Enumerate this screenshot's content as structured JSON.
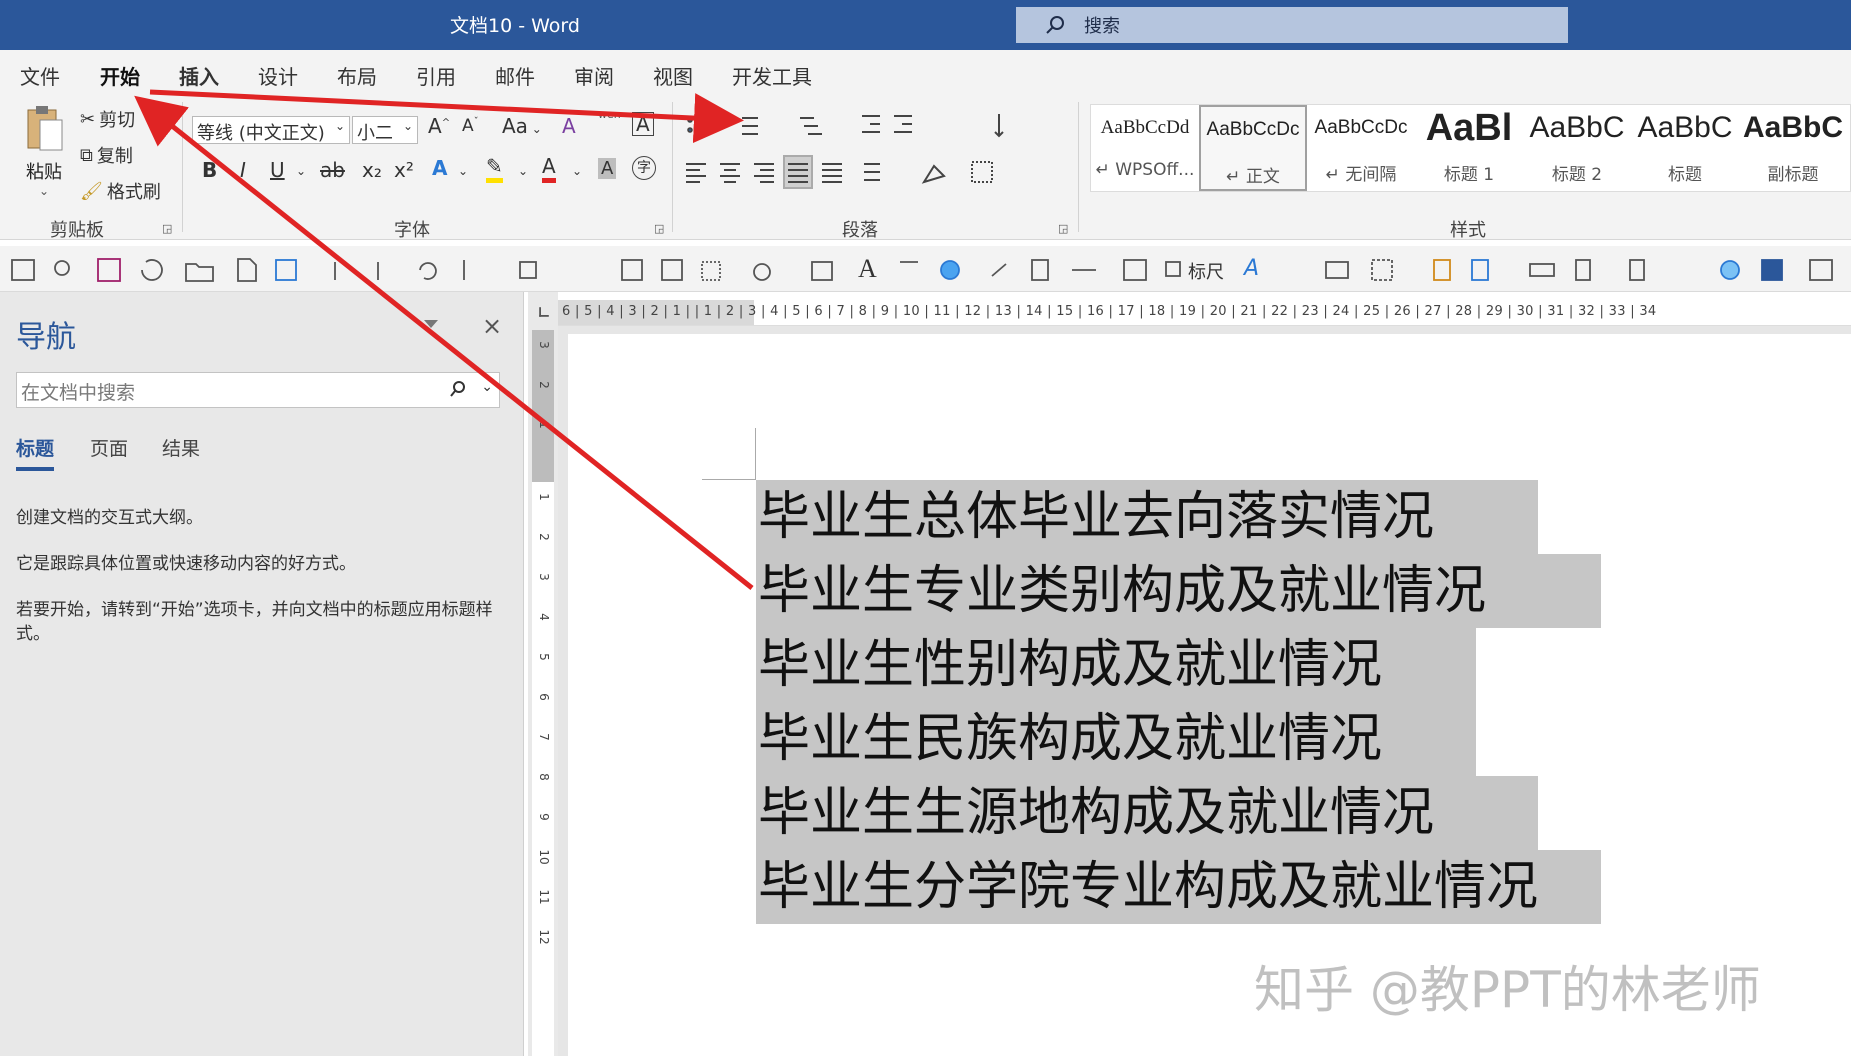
{
  "window": {
    "title": "文档10  -  Word",
    "search_label": "搜索"
  },
  "tabs": [
    "文件",
    "开始",
    "插入",
    "设计",
    "布局",
    "引用",
    "邮件",
    "审阅",
    "视图",
    "开发工具"
  ],
  "ribbon": {
    "clipboard": {
      "paste": "粘贴",
      "cut": "剪切",
      "copy": "复制",
      "format_painter": "格式刷",
      "group": "剪贴板"
    },
    "font": {
      "font_name": "等线 (中文正文)",
      "font_size": "小二",
      "change_case": "Aa",
      "phonetic": "wen",
      "group": "字体",
      "bold": "B",
      "italic": "I",
      "underline": "U",
      "strike": "ab",
      "subscript": "x₂",
      "superscript": "x²",
      "effects": "A",
      "color": "A",
      "shade": "A",
      "circle": "字"
    },
    "paragraph": {
      "group": "段落"
    },
    "styles": {
      "group": "样式",
      "items": [
        {
          "sample": "AaBbCcDd",
          "name": "↵ WPSOff..."
        },
        {
          "sample": "AaBbCcDc",
          "name": "↵ 正文"
        },
        {
          "sample": "AaBbCcDc",
          "name": "↵ 无间隔"
        },
        {
          "sample": "AaBl",
          "name": "标题 1"
        },
        {
          "sample": "AaBbC",
          "name": "标题 2"
        },
        {
          "sample": "AaBbC",
          "name": "标题"
        },
        {
          "sample": "AaBbC",
          "name": "副标题"
        }
      ]
    }
  },
  "qat": {
    "ruler_label": "标尺"
  },
  "navigation": {
    "title": "导航",
    "close": "×",
    "search_placeholder": "在文档中搜索",
    "tabs": [
      "标题",
      "页面",
      "结果"
    ],
    "messages": [
      "创建文档的交互式大纲。",
      "它是跟踪具体位置或快速移动内容的好方式。",
      "若要开始，请转到“开始”选项卡，并向文档中的标题应用标题样式。"
    ]
  },
  "ruler": {
    "horizontal": "6 | 5 | 4 | 3 | 2 | 1 |   | 1 | 2 | 3 | 4 | 5 | 6 | 7 | 8 | 9 | 10 | 11 | 12 | 13 | 14 | 15 | 16 | 17 | 18 | 19 | 20 | 21 | 22 | 23 | 24 | 25 | 26 | 27 | 28 | 29 | 30 | 31 | 32 | 33 | 34",
    "vertical": [
      "3",
      "2",
      "1",
      "1",
      "2",
      "3",
      "4",
      "5",
      "6",
      "7",
      "8",
      "9",
      "10",
      "11",
      "12"
    ]
  },
  "document": {
    "lines": [
      "毕业生总体毕业去向落实情况",
      "毕业生专业类别构成及就业情况",
      "毕业生性别构成及就业情况",
      "毕业生民族构成及就业情况",
      "毕业生生源地构成及就业情况",
      "毕业生分学院专业构成及就业情况"
    ]
  },
  "watermark": "知乎 @教PPT的林老师",
  "colors": {
    "accent": "#2b579a",
    "selection": "#c6c6c6",
    "arrow": "#e02424"
  }
}
